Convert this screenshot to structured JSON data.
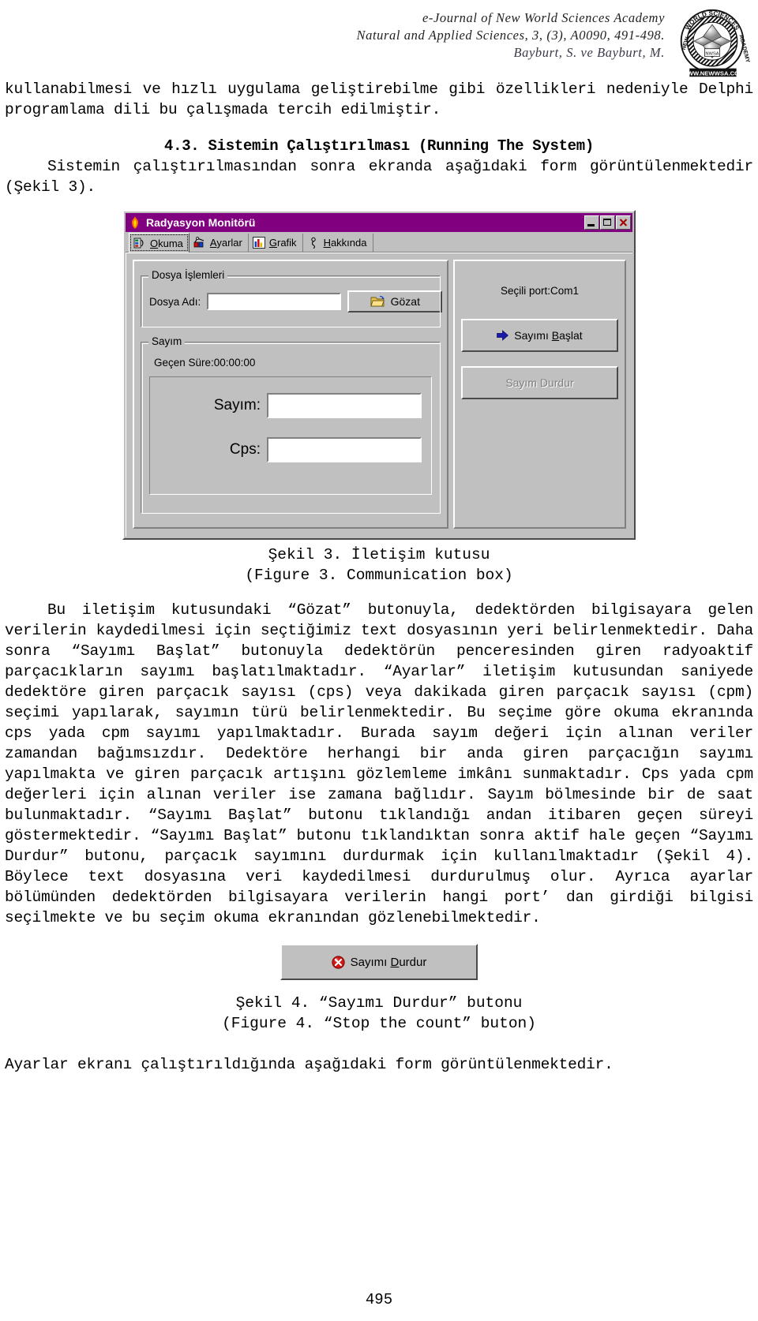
{
  "header": {
    "line1": "e-Journal of New World Sciences Academy",
    "line2": "Natural and Applied Sciences, 3, (3), A0090, 491-498.",
    "line3": "Bayburt, S. ve Bayburt, M.",
    "logo_top_text": "WORLD SCIENCES",
    "logo_left_text": "NEW",
    "logo_right_text": "ACADEMY",
    "logo_center_text": "NWSA",
    "logo_url_text": "WWW.NEWWSA.COM"
  },
  "body": {
    "para1": "kullanabilmesi ve hızlı uygulama geliştirebilme gibi özellikleri nedeniyle Delphi programlama dili bu çalışmada tercih edilmiştir.",
    "section_heading": "4.3. Sistemin Çalıştırılması (Running The System)",
    "para2": "Sistemin çalıştırılmasından sonra ekranda aşağıdaki form görüntülenmektedir (Şekil 3).",
    "caption3_line1": "Şekil 3. İletişim kutusu",
    "caption3_line2": "(Figure 3. Communication box)",
    "para3": "Bu iletişim kutusundaki “Gözat” butonuyla, dedektörden bilgisayara gelen verilerin kaydedilmesi için seçtiğimiz text dosyasının yeri belirlenmektedir. Daha sonra “Sayımı Başlat” butonuyla dedektörün penceresinden giren radyoaktif parçacıkların sayımı başlatılmaktadır. “Ayarlar” iletişim kutusundan saniyede dedektöre giren parçacık sayısı (cps) veya dakikada giren parçacık sayısı (cpm) seçimi yapılarak, sayımın türü belirlenmektedir. Bu seçime göre okuma ekranında cps yada cpm sayımı yapılmaktadır. Burada sayım değeri için alınan veriler zamandan bağımsızdır. Dedektöre herhangi bir anda giren parçacığın sayımı yapılmakta ve giren parçacık artışını gözlemleme imkânı sunmaktadır. Cps yada cpm değerleri için alınan veriler ise zamana bağlıdır. Sayım bölmesinde bir de saat bulunmaktadır. “Sayımı Başlat” butonu tıklandığı andan itibaren geçen süreyi göstermektedir. “Sayımı Başlat” butonu tıklandıktan sonra aktif hale geçen “Sayımı Durdur” butonu, parçacık sayımını durdurmak için kullanılmaktadır (Şekil 4). Böylece text dosyasına veri kaydedilmesi durdurulmuş olur. Ayrıca ayarlar bölümünden dedektörden bilgisayara verilerin hangi port’ dan girdiği bilgisi seçilmekte ve bu seçim okuma ekranından gözlenebilmektedir.",
    "caption4_line1": "Şekil 4. “Sayımı Durdur” butonu",
    "caption4_line2": "(Figure 4. “Stop the count” buton)",
    "para4": "Ayarlar ekranı çalıştırıldığında aşağıdaki form görüntülenmektedir.",
    "page_number": "495"
  },
  "dialog": {
    "title": "Radyasyon Monitörü",
    "titlebar_color": "#800080",
    "window_buttons": [
      {
        "name": "minimize",
        "glyph": "_"
      },
      {
        "name": "maximize",
        "glyph": "□"
      },
      {
        "name": "close",
        "glyph": "✕"
      }
    ],
    "tabs": [
      {
        "label": "Okuma",
        "accel": "O",
        "icon": "reading-icon",
        "active": true
      },
      {
        "label": "Ayarlar",
        "accel": "A",
        "icon": "settings-icon",
        "active": false
      },
      {
        "label": "Grafik",
        "accel": "G",
        "icon": "chart-icon",
        "active": false
      },
      {
        "label": "Hakkında",
        "accel": "H",
        "icon": "about-icon",
        "active": false
      }
    ],
    "file_group": {
      "title": "Dosya İşlemleri",
      "filename_label": "Dosya Adı:",
      "filename_value": "",
      "browse_label": "Gözat",
      "browse_icon": "open-folder-icon"
    },
    "count_group": {
      "title": "Sayım",
      "elapsed_label": "Geçen Süre:00:00:00",
      "count_label": "Sayım:",
      "count_value": "",
      "cps_label": "Cps:",
      "cps_value": ""
    },
    "right_panel": {
      "port_label": "Seçili port:Com1",
      "start_label": "Sayımı Başlat",
      "start_accel": "B",
      "start_icon": "blue-arrow-icon",
      "stop_label": "Sayım Durdur",
      "stop_enabled": false
    }
  },
  "figure4_button": {
    "label": "Sayımı Durdur",
    "accel": "D",
    "icon": "red-stop-icon"
  }
}
